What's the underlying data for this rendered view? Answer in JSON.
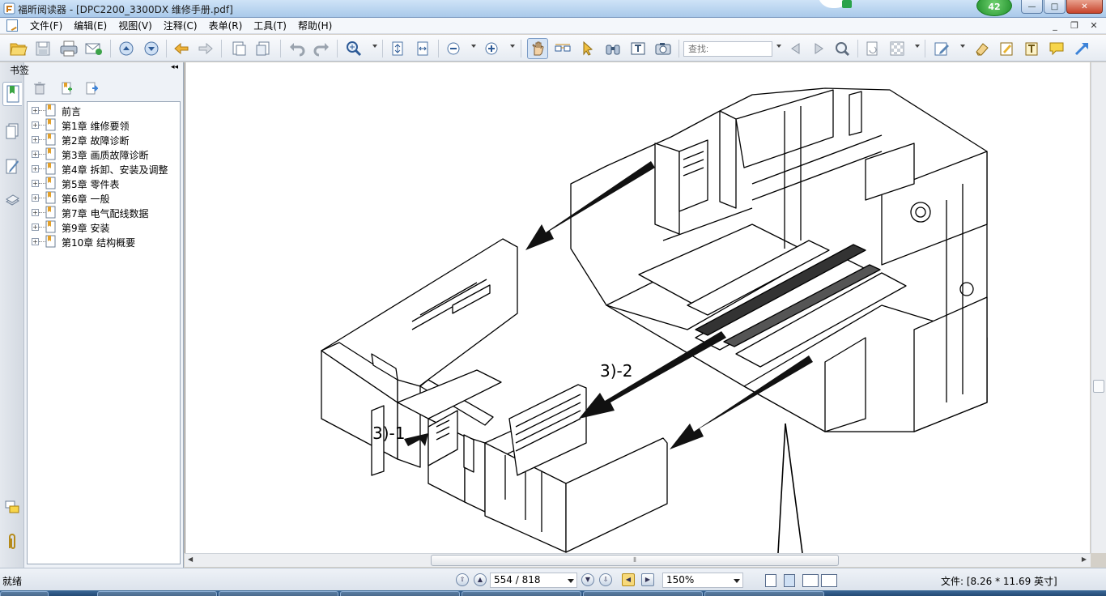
{
  "window": {
    "title": "福昕阅读器 - [DPC2200_3300DX 维修手册.pdf]",
    "notification_count": "42",
    "buttons": {
      "minimize": "—",
      "maximize": "□",
      "close": "✕"
    }
  },
  "menu": {
    "items": [
      "文件(F)",
      "编辑(E)",
      "视图(V)",
      "注释(C)",
      "表单(R)",
      "工具(T)",
      "帮助(H)"
    ],
    "mdi": [
      "_",
      "❐",
      "✕"
    ]
  },
  "toolbar": {
    "search_placeholder": "查找:"
  },
  "bookmarks": {
    "panel_title": "书签",
    "collapse_glyph": "◂◂",
    "items": [
      {
        "label": "前言"
      },
      {
        "label": "第1章 维修要领"
      },
      {
        "label": "第2章 故障诊断"
      },
      {
        "label": "第3章 画质故障诊断"
      },
      {
        "label": "第4章 拆卸、安装及调整"
      },
      {
        "label": "第5章 零件表"
      },
      {
        "label": "第6章 一般"
      },
      {
        "label": "第7章 电气配线数据"
      },
      {
        "label": "第9章 安装"
      },
      {
        "label": "第10章 结构概要"
      }
    ]
  },
  "document": {
    "callouts": [
      "3)-2",
      "3)-1"
    ]
  },
  "hscroll_grip": "⦀",
  "status": {
    "ready_text": "就绪",
    "page_indicator": "554 / 818",
    "zoom": "150%",
    "file_info": "文件: [8.26 * 11.69 英寸]"
  }
}
